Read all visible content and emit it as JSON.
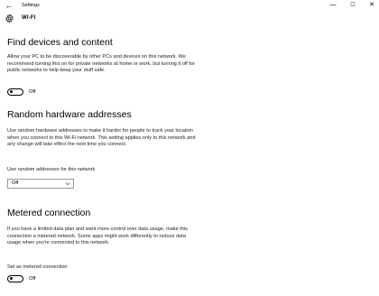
{
  "window": {
    "title": "Settings",
    "back_glyph": "←",
    "minimize_glyph": "—",
    "maximize_glyph": "☐",
    "close_glyph": "✕"
  },
  "header": {
    "icon": "gear-icon",
    "title": "WI-FI"
  },
  "sections": [
    {
      "heading": "Find devices and content",
      "description": "Allow your PC to be discoverable by other PCs and devices on this network. We recommend turning this on for private networks at home or work, but turning it off for public networks to help keep your stuff safe.",
      "toggle_state": "Off"
    },
    {
      "heading": "Random hardware addresses",
      "description": "Use random hardware addresses to make it harder for people to track your location when you connect to this Wi-Fi network. This setting applies only to this network and any change will take effect the next time you connect.",
      "select_label": "Use random addresses for this network",
      "select_value": "Off"
    },
    {
      "heading": "Metered connection",
      "description": "If you have a limited data plan and want more control over data usage, make this connection a metered network. Some apps might work differently to reduce data usage when you're connected to this network.",
      "toggle_label": "Set as metered connection",
      "toggle_state": "Off"
    }
  ]
}
